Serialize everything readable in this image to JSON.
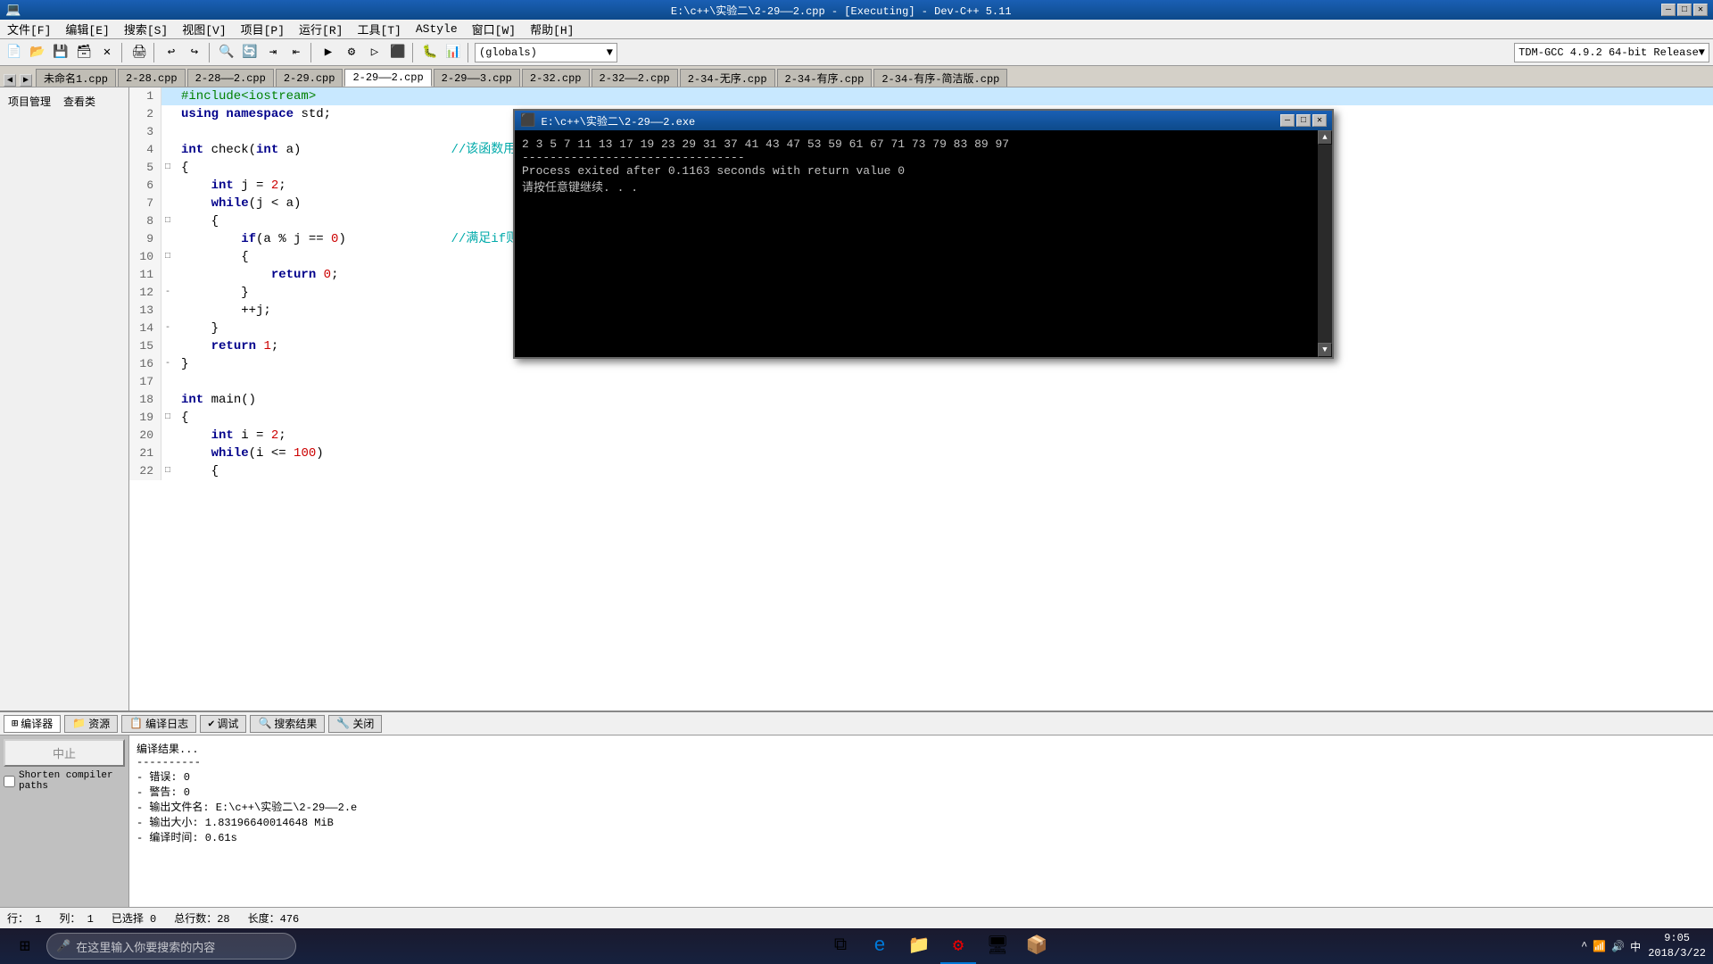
{
  "titlebar": {
    "title": "E:\\c++\\实验二\\2-29——2.cpp - [Executing] - Dev-C++ 5.11",
    "min": "—",
    "max": "□",
    "close": "✕"
  },
  "menubar": {
    "items": [
      "文件[F]",
      "编辑[E]",
      "搜索[S]",
      "视图[V]",
      "项目[P]",
      "运行[R]",
      "工具[T]",
      "AStyle",
      "窗口[W]",
      "帮助[H]"
    ]
  },
  "toolbar": {
    "dropdown1": "(globals)",
    "dropdown2": "TDM-GCC 4.9.2 64-bit Release"
  },
  "tabs": {
    "nav_left": "◀",
    "nav_right": "▶",
    "items": [
      "未命名1.cpp",
      "2-28.cpp",
      "2-28——2.cpp",
      "2-29.cpp",
      "2-29——2.cpp",
      "2-29——3.cpp",
      "2-32.cpp",
      "2-32——2.cpp",
      "2-34-无序.cpp",
      "2-34-有序.cpp",
      "2-34-有序-简洁版.cpp"
    ],
    "active": "2-29——2.cpp"
  },
  "sidebar": {
    "tab1": "项目管理",
    "tab2": "查看类"
  },
  "code": {
    "lines": [
      {
        "num": 1,
        "fold": "",
        "highlighted": true,
        "content": "#include<iostream>"
      },
      {
        "num": 2,
        "fold": "",
        "highlighted": false,
        "content": "using namespace std;"
      },
      {
        "num": 3,
        "fold": "",
        "highlighted": false,
        "content": ""
      },
      {
        "num": 4,
        "fold": "",
        "highlighted": false,
        "content": "int check(int a)                    //该函数用于检查a是否为质数，若是则返回1，否则返回0"
      },
      {
        "num": 5,
        "fold": "□",
        "highlighted": false,
        "content": "{"
      },
      {
        "num": 6,
        "fold": "",
        "highlighted": false,
        "content": "    int j = 2;"
      },
      {
        "num": 7,
        "fold": "",
        "highlighted": false,
        "content": "    while(j < a)"
      },
      {
        "num": 8,
        "fold": "□",
        "highlighted": false,
        "content": "    {"
      },
      {
        "num": 9,
        "fold": "",
        "highlighted": false,
        "content": "        if(a % j == 0)              //满足if则数a不是质数"
      },
      {
        "num": 10,
        "fold": "□",
        "highlighted": false,
        "content": "        {"
      },
      {
        "num": 11,
        "fold": "",
        "highlighted": false,
        "content": "            return 0;"
      },
      {
        "num": 12,
        "fold": "-",
        "highlighted": false,
        "content": "        }"
      },
      {
        "num": 13,
        "fold": "",
        "highlighted": false,
        "content": "        ++j;"
      },
      {
        "num": 14,
        "fold": "-",
        "highlighted": false,
        "content": "    }"
      },
      {
        "num": 15,
        "fold": "",
        "highlighted": false,
        "content": "    return 1;"
      },
      {
        "num": 16,
        "fold": "-",
        "highlighted": false,
        "content": "}"
      },
      {
        "num": 17,
        "fold": "",
        "highlighted": false,
        "content": ""
      },
      {
        "num": 18,
        "fold": "",
        "highlighted": false,
        "content": "int main()"
      },
      {
        "num": 19,
        "fold": "□",
        "highlighted": false,
        "content": "{"
      },
      {
        "num": 20,
        "fold": "",
        "highlighted": false,
        "content": "    int i = 2;"
      },
      {
        "num": 21,
        "fold": "",
        "highlighted": false,
        "content": "    while(i <= 100)"
      },
      {
        "num": 22,
        "fold": "□",
        "highlighted": false,
        "content": "    {"
      }
    ]
  },
  "bottom_tabs": {
    "items": [
      "编译器",
      "资源",
      "编译日志",
      "调试",
      "搜索结果",
      "关闭"
    ],
    "active": "编译器",
    "icons": [
      "⊞",
      "📁",
      "📋",
      "✔",
      "🔍",
      "🔧",
      "✕"
    ]
  },
  "bottom": {
    "stop_btn": "中止",
    "shorten_label": "Shorten compiler paths",
    "compiler_output": [
      "编译结果...",
      "----------",
      "- 错误: 0",
      "- 警告: 0",
      "- 输出文件名: E:\\c++\\实验二\\2-29——2.e",
      "- 输出大小: 1.83196640014648 MiB",
      "- 编译时间: 0.61s"
    ]
  },
  "statusbar": {
    "row_label": "行：",
    "row_val": "1",
    "col_label": "列：",
    "col_val": "1",
    "selected_label": "已选择",
    "selected_val": "0",
    "lines_label": "总行数：",
    "lines_val": "28",
    "length_label": "长度：",
    "length_val": "476"
  },
  "console": {
    "title": "E:\\c++\\实验二\\2-29——2.exe",
    "min": "—",
    "max": "□",
    "close": "✕",
    "line1": "2  3  5  7  11  13  17  19  23  29  31  37  41  43  47  53  59  61  67  71  73  79  83  89  97",
    "separator": "--------------------------------",
    "line2": "Process exited after 0.1163 seconds with return value 0",
    "line3": "请按任意键继续. . ."
  },
  "taskbar": {
    "search_placeholder": "在这里输入你要搜索的内容",
    "apps": [
      "⊞",
      "🔍",
      "🌐",
      "📁",
      "🖥",
      "💻",
      "🎮",
      "📦"
    ],
    "time": "9:05",
    "date": "2018/3/22"
  }
}
